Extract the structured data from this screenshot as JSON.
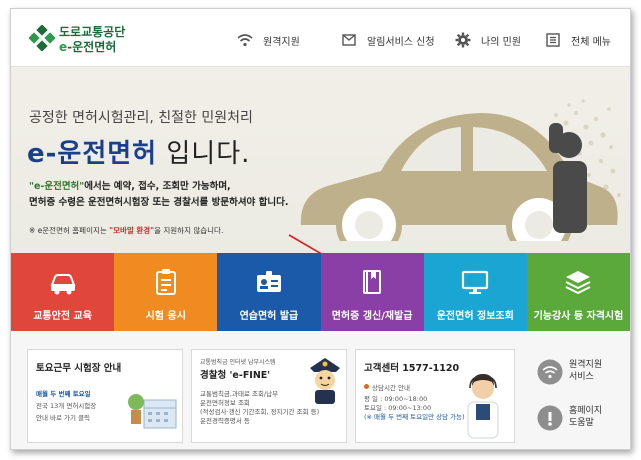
{
  "header": {
    "logo_line1": "도로교통공단",
    "logo_line2_e": "e",
    "logo_line2_rest": "-운전면허",
    "nav": [
      {
        "label": "원격지원",
        "icon": "wifi-icon"
      },
      {
        "label": "알림서비스 신청",
        "icon": "mail-icon"
      },
      {
        "label": "나의 민원",
        "icon": "gear-icon"
      },
      {
        "label": "전체 메뉴",
        "icon": "menu-list-icon"
      }
    ]
  },
  "hero": {
    "subtitle": "공정한 면허시험관리, 친절한 민원처리",
    "title_brand": "e-운전면허",
    "title_rest": " 입니다.",
    "desc_hl": "\"e-운전면허\"",
    "desc_line1_rest": "에서는 예약, 접수, 조회만 가능하며,",
    "desc_line2": "면허증 수령은 운전면허시험장 또는 경찰서를 방문하셔야 합니다.",
    "note_prefix": "※ e운전면허 홈페이지는 ",
    "note_link": "\"모바일 환경\"",
    "note_suffix": "을 지원하지 않습니다."
  },
  "tiles": [
    {
      "label": "교통안전 교육",
      "icon": "car-icon",
      "color": "#e0463a"
    },
    {
      "label": "시험 응시",
      "icon": "clipboard-icon",
      "color": "#f08b22"
    },
    {
      "label": "연습면허 발급",
      "icon": "id-card-icon",
      "color": "#1a5aa8"
    },
    {
      "label": "면허증 갱신/재발급",
      "icon": "book-icon",
      "color": "#8a3fa6"
    },
    {
      "label": "운전면허 정보조회",
      "icon": "monitor-icon",
      "color": "#1aa5d2"
    },
    {
      "label": "기능강사 등 자격시험",
      "icon": "layers-icon",
      "color": "#5aa93a"
    }
  ],
  "cards": {
    "weekend": {
      "title": "토요근무 시험장 안내",
      "line1": "매월 두 번째 토요일",
      "line2": "전국 13개 면허시험장",
      "line3": "안내 바로 가기 클릭"
    },
    "efine": {
      "top": "교통범칙금 인터넷 납부시스템",
      "title": "경찰청 'e-FINE'",
      "line1": "교통범칙금,과태료 조회/납부",
      "line2": "운전면허정보 조회",
      "line3": "(적성검사·갱신 기간조회, 정지기간 조회 등)",
      "line4": "운전경력증명서 등"
    },
    "center": {
      "title": "고객센터 1577-1120",
      "line1": "상담시간 안내",
      "line2": "평   일 : 09:00~18:00",
      "line3": "토요일 : 09:00~13:00",
      "line4": "(※ 매월 두 번째 토요일만 상담 가능)"
    },
    "side": [
      {
        "label_line1": "원격지원",
        "label_line2": "서비스",
        "icon": "wifi-icon"
      },
      {
        "label_line1": "홈페이지",
        "label_line2": "도움말",
        "icon": "help-icon"
      }
    ]
  },
  "colors": {
    "brand_green": "#1d6b3a",
    "brand_blue": "#1a3f8f",
    "accent_red": "#cc2b2b"
  }
}
